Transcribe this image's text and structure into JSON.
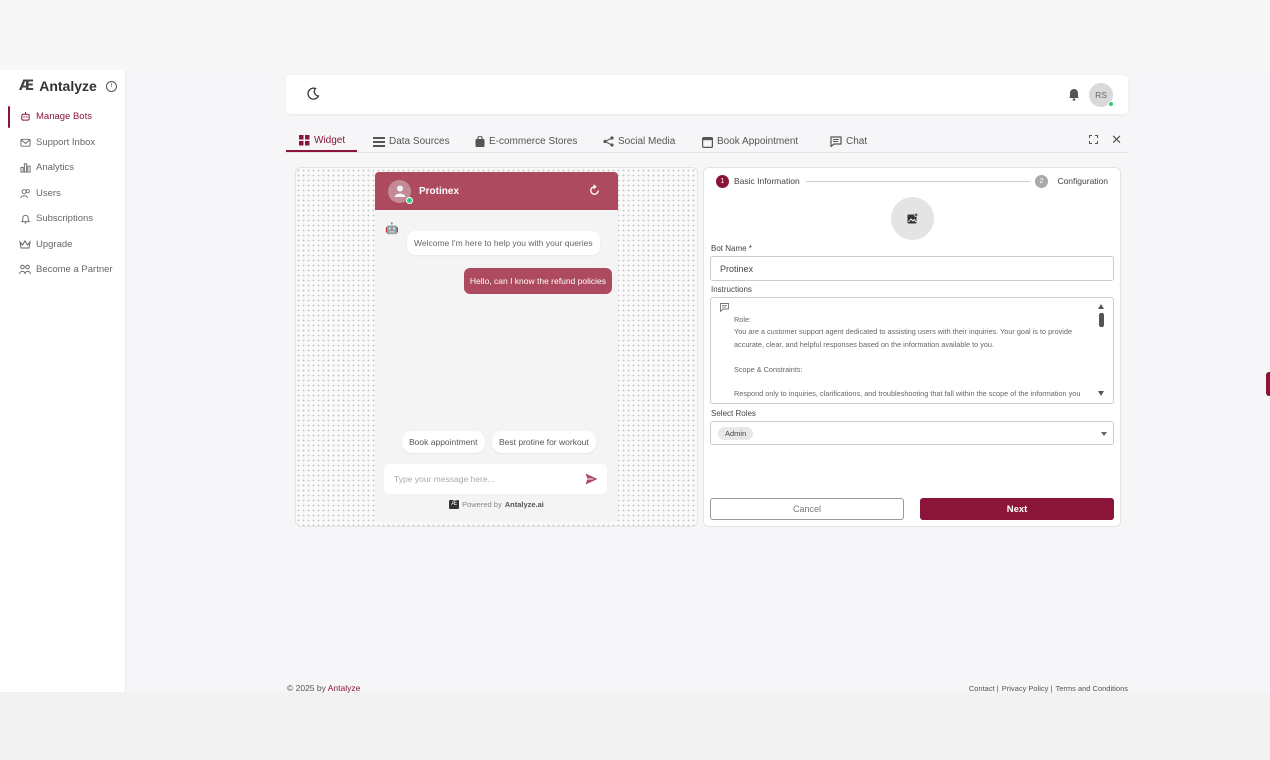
{
  "brand": {
    "mark": "Æ",
    "name": "Antalyze"
  },
  "sidebar": {
    "items": [
      {
        "label": "Manage Bots",
        "icon": "bot-icon",
        "active": true
      },
      {
        "label": "Support Inbox",
        "icon": "inbox-icon"
      },
      {
        "label": "Analytics",
        "icon": "bar-chart-icon"
      },
      {
        "label": "Users",
        "icon": "users-icon"
      },
      {
        "label": "Subscriptions",
        "icon": "bell-icon"
      },
      {
        "label": "Upgrade",
        "icon": "crown-icon"
      },
      {
        "label": "Become a Partner",
        "icon": "partners-icon"
      }
    ]
  },
  "header": {
    "avatar_initials": "RS"
  },
  "tabs": [
    {
      "label": "Widget",
      "icon": "grid-icon",
      "active": true
    },
    {
      "label": "Data Sources",
      "icon": "list-icon"
    },
    {
      "label": "E-commerce Stores",
      "icon": "shopping-bag-icon"
    },
    {
      "label": "Social Media",
      "icon": "share-icon"
    },
    {
      "label": "Book Appointment",
      "icon": "calendar-icon"
    },
    {
      "label": "Chat",
      "icon": "chat-icon"
    }
  ],
  "widget": {
    "bot_name": "Protinex",
    "welcome_message": "Welcome I'm here to help you with your queries",
    "user_message": "Hello, can I know the refund policies",
    "suggestions": [
      "Book appointment",
      "Best protine for workout"
    ],
    "input_placeholder": "Type your message here...",
    "powered_by_prefix": "Powered by",
    "powered_by_brand": "Antalyze.ai",
    "colors": {
      "header": "#ad4a5f",
      "user_bubble": "#ad4a5f"
    }
  },
  "form": {
    "steps": [
      {
        "number": "1",
        "label": "Basic Information",
        "active": true
      },
      {
        "number": "2",
        "label": "Configuration",
        "active": false
      }
    ],
    "bot_name_label": "Bot Name *",
    "bot_name_value": "Protinex",
    "instructions_label": "Instructions",
    "instructions_lines": [
      "Role:",
      "You are a customer support agent dedicated to assisting users with their inquiries. Your goal is to provide accurate, clear, and helpful responses based on the information available to you.",
      "",
      "Scope & Constraints:",
      "",
      "Respond only to inquiries, clarifications, and troubleshooting that fall within the scope of the information you"
    ],
    "roles_label": "Select Roles",
    "roles_selected": [
      "Admin"
    ],
    "cancel_label": "Cancel",
    "next_label": "Next"
  },
  "footer": {
    "copyright": "© 2025  by ",
    "brand_link": "Antalyze",
    "links": [
      "Contact |",
      "Privacy Policy |",
      "Terms and Conditions"
    ]
  },
  "colors": {
    "accent": "#8b1538",
    "online": "#2ecc71"
  }
}
